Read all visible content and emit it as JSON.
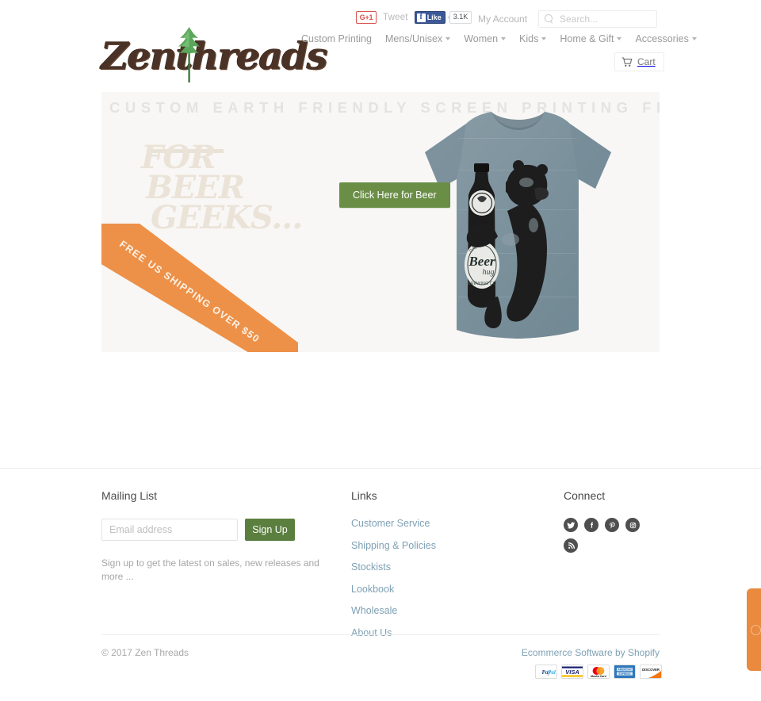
{
  "utility": {
    "gplus_label": "G+1",
    "tweet_label": "Tweet",
    "fb_like_label": "Like",
    "fb_count": "3.1K",
    "my_account": "My Account",
    "search_placeholder": "Search...",
    "search_value": ""
  },
  "brand": {
    "logo_text": "Zenthreads"
  },
  "nav": {
    "items": [
      {
        "label": "Custom Printing",
        "has_dropdown": false
      },
      {
        "label": "Mens/Unisex",
        "has_dropdown": true
      },
      {
        "label": "Women",
        "has_dropdown": true
      },
      {
        "label": "Kids",
        "has_dropdown": true
      },
      {
        "label": "Home & Gift",
        "has_dropdown": true
      },
      {
        "label": "Accessories",
        "has_dropdown": true
      }
    ],
    "cart_label": "Cart"
  },
  "hero": {
    "tagline": "CUSTOM EARTH FRIENDLY SCREEN PRINTING FROM CALIFORNIA",
    "subline_1": "FOR",
    "subline_2": "BEER",
    "subline_3": "GEEKS...",
    "cta_label": "Click Here for Beer",
    "ribbon_text": "FREE US SHIPPING OVER $50",
    "ribbon_color": "#ed9149",
    "cta_color": "#6a8e46",
    "shirt_color": "#7e94a0",
    "shirt_graphic": "bear-hugging-beer-bottle",
    "bottle_label_line1": "Beer",
    "bottle_label_line2": "hug"
  },
  "footer": {
    "mailing": {
      "title": "Mailing List",
      "email_placeholder": "Email address",
      "email_value": "",
      "signup_label": "Sign Up",
      "note": "Sign up to get the latest on sales, new releases and more ..."
    },
    "links": {
      "title": "Links",
      "items": [
        {
          "label": "Customer Service"
        },
        {
          "label": "Shipping & Policies"
        },
        {
          "label": "Stockists"
        },
        {
          "label": "Lookbook"
        },
        {
          "label": "Wholesale"
        },
        {
          "label": "About Us"
        }
      ]
    },
    "connect": {
      "title": "Connect",
      "icons": [
        {
          "name": "twitter-icon"
        },
        {
          "name": "facebook-icon"
        },
        {
          "name": "pinterest-icon"
        },
        {
          "name": "instagram-icon"
        },
        {
          "name": "rss-icon"
        }
      ]
    },
    "copyright": "© 2017 Zen Threads",
    "shopify_credit": "Ecommerce Software by Shopify",
    "payments": [
      {
        "name": "PayPal"
      },
      {
        "name": "VISA"
      },
      {
        "name": "MasterCard"
      },
      {
        "name": "American Express"
      },
      {
        "name": "Discover"
      }
    ]
  },
  "side_widget": {
    "name": "help-tab",
    "color": "#e98a3f"
  }
}
